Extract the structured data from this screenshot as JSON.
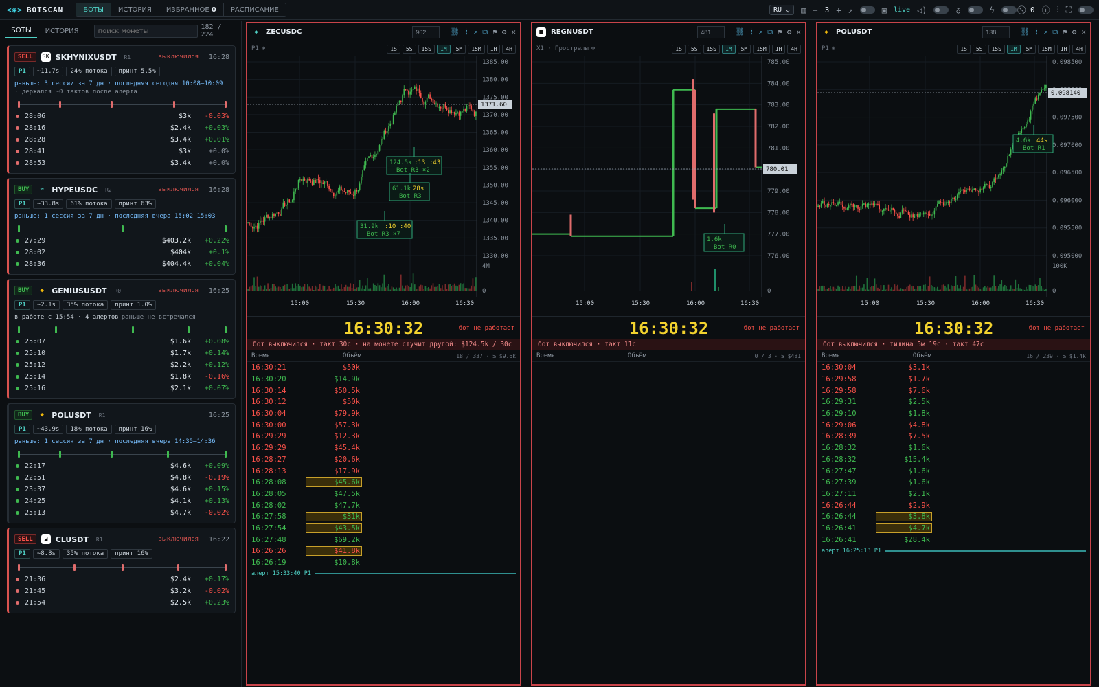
{
  "app": {
    "name": "BOTSCAN"
  },
  "nav": {
    "tabs": [
      "БОТЫ",
      "ИСТОРИЯ",
      "ИЗБРАННОЕ",
      "РАСПИСАНИЕ"
    ],
    "fav_count": "0",
    "active": "БОТЫ"
  },
  "toolbar": {
    "lang": "RU",
    "grid_minus": "−",
    "grid_count": "3",
    "grid_plus": "+",
    "live": "live",
    "blocked_count": "0"
  },
  "sidebar": {
    "tabs": [
      "БОТЫ",
      "ИСТОРИЯ"
    ],
    "search_placeholder": "поиск монеты",
    "count": "182 / 224",
    "cards": [
      {
        "side": "SELL",
        "symbol": "SKHYNIXUSDT",
        "rank": "R1",
        "status": "выключился",
        "time": "16:28",
        "p": "P1",
        "lat": "~11.7s",
        "flow": "24% потока",
        "print": "принт 5.5%",
        "note": "раньше: 3 сессии за 7 дн · последняя сегодня 10:08–10:09",
        "note2": "· держался ~0 тактов после алерта",
        "icon_color": "#ffffff",
        "icon_txt": "SK",
        "ticks": [
          0,
          0.2,
          0.45,
          0.75,
          1.0
        ],
        "tick_color": "#e06c6c",
        "rows": [
          [
            "28:06",
            "$3k",
            "-0.03%"
          ],
          [
            "28:16",
            "$2.4k",
            "+0.03%"
          ],
          [
            "28:28",
            "$3.4k",
            "+0.01%"
          ],
          [
            "28:41",
            "$3k",
            "+0.0%"
          ],
          [
            "28:53",
            "$3.4k",
            "+0.0%"
          ]
        ]
      },
      {
        "side": "BUY",
        "symbol": "HYPEUSDC",
        "rank": "R2",
        "status": "выключился",
        "time": "16:28",
        "p": "P1",
        "lat": "~33.8s",
        "flow": "61% потока",
        "print": "принт 63%",
        "note": "раньше: 1 сессия за 7 дн · последняя вчера 15:02–15:03",
        "note2": "",
        "icon_color": "#4fd1c5",
        "icon_txt": "≈",
        "ticks": [
          0,
          0.5,
          1.0
        ],
        "tick_color": "#3fb950",
        "rows": [
          [
            "27:29",
            "$403.2k",
            "+0.22%"
          ],
          [
            "28:02",
            "$404k",
            "+0.1%"
          ],
          [
            "28:36",
            "$404.4k",
            "+0.04%"
          ]
        ]
      },
      {
        "side": "BUY",
        "symbol": "GENIUSUSDT",
        "rank": "R0",
        "status": "выключился",
        "time": "16:25",
        "p": "P1",
        "lat": "~2.1s",
        "flow": "35% потока",
        "print": "принт 1.0%",
        "note": "в работе с 15:54 · 4 алертов",
        "note_tail": "раньше не встречался",
        "note2": "",
        "icon_color": "#f0b90b",
        "icon_txt": "◆",
        "ticks": [
          0,
          0.18,
          0.55,
          0.82,
          1.0
        ],
        "tick_color": "#3fb950",
        "rows": [
          [
            "25:07",
            "$1.6k",
            "+0.08%"
          ],
          [
            "25:10",
            "$1.7k",
            "+0.14%"
          ],
          [
            "25:12",
            "$2.2k",
            "+0.12%"
          ],
          [
            "25:14",
            "$1.8k",
            "-0.16%"
          ],
          [
            "25:16",
            "$2.1k",
            "+0.07%"
          ]
        ]
      },
      {
        "side": "BUY",
        "symbol": "POLUSDT",
        "rank": "R1",
        "status": "",
        "time": "16:25",
        "p": "P1",
        "lat": "~43.9s",
        "flow": "18% потока",
        "print": "принт 16%",
        "note": "раньше: 1 сессия за 7 дн · последняя вчера 14:35–14:36",
        "note2": "",
        "icon_color": "#f0b90b",
        "icon_txt": "◆",
        "ticks": [
          0,
          0.2,
          0.45,
          0.72,
          1.0
        ],
        "tick_color": "#3fb950",
        "rows": [
          [
            "22:17",
            "$4.6k",
            "+0.09%"
          ],
          [
            "22:51",
            "$4.8k",
            "-0.19%"
          ],
          [
            "23:37",
            "$4.6k",
            "+0.15%"
          ],
          [
            "24:25",
            "$4.1k",
            "+0.13%"
          ],
          [
            "25:13",
            "$4.7k",
            "-0.02%"
          ]
        ]
      },
      {
        "side": "SELL",
        "symbol": "CLUSDT",
        "rank": "R1",
        "status": "выключился",
        "time": "16:22",
        "p": "P1",
        "lat": "~8.8s",
        "flow": "35% потока",
        "print": "принт 16%",
        "note": "",
        "note2": "",
        "icon_color": "#ffffff",
        "icon_txt": "◢",
        "ticks": [
          0,
          0.27,
          0.5,
          0.77,
          1.0
        ],
        "tick_color": "#e06c6c",
        "rows": [
          [
            "21:36",
            "$2.4k",
            "+0.17%"
          ],
          [
            "21:45",
            "$3.2k",
            "-0.02%"
          ],
          [
            "21:54",
            "$2.5k",
            "+0.23%"
          ]
        ]
      }
    ]
  },
  "timeframes": [
    "1S",
    "5S",
    "15S",
    "1M",
    "5M",
    "15M",
    "1H",
    "4H"
  ],
  "panels": [
    {
      "symbol": "ZECUSDC",
      "input": "962",
      "sub": "P1",
      "clock": "16:30:32",
      "status": "бот не работает",
      "banner": "бот выключился · такт 30с · на монете стучит другой: $124.5k / 30с",
      "col_time": "Время",
      "col_vol": "Объём",
      "meta": "18 / 337 · ≥ $9.6k",
      "alert": "алерт 15:33:40 P1",
      "icon_color": "#4fd1c5",
      "trades": [
        [
          "16:30:21",
          "$50k",
          "r",
          0
        ],
        [
          "16:30:20",
          "$14.9k",
          "g",
          0
        ],
        [
          "16:30:14",
          "$50.5k",
          "r",
          0
        ],
        [
          "16:30:12",
          "$50k",
          "r",
          0
        ],
        [
          "16:30:04",
          "$79.9k",
          "r",
          0
        ],
        [
          "16:30:00",
          "$57.3k",
          "r",
          0
        ],
        [
          "16:29:29",
          "$12.3k",
          "r",
          0
        ],
        [
          "16:29:29",
          "$45.4k",
          "r",
          0
        ],
        [
          "16:28:27",
          "$20.6k",
          "r",
          0
        ],
        [
          "16:28:13",
          "$17.9k",
          "r",
          0
        ],
        [
          "16:28:08",
          "$45.6k",
          "g",
          1
        ],
        [
          "16:28:05",
          "$47.5k",
          "g",
          0
        ],
        [
          "16:28:02",
          "$47.7k",
          "g",
          0
        ],
        [
          "16:27:58",
          "$31k",
          "g",
          1
        ],
        [
          "16:27:54",
          "$43.5k",
          "g",
          1
        ],
        [
          "16:27:48",
          "$69.2k",
          "g",
          0
        ],
        [
          "16:26:26",
          "$41.8k",
          "r",
          1
        ],
        [
          "16:26:19",
          "$10.8k",
          "g",
          0
        ]
      ],
      "chart": {
        "yticks": [
          "1385.00",
          "1380.00",
          "1375.00",
          "1370.00",
          "1365.00",
          "1360.00",
          "1355.00",
          "1350.00",
          "1345.00",
          "1340.00",
          "1335.00",
          "1330.00"
        ],
        "price": "1371.60",
        "xticks": [
          "15:00",
          "15:30",
          "16:00",
          "16:30"
        ],
        "vol": [
          "4M",
          "0"
        ],
        "labels": [
          {
            "a": "124.5k",
            "b": ":13",
            "c": ":43",
            "d": "Bot R3 ×2"
          },
          {
            "a": "61.1k",
            "b": "28s",
            "c": "",
            "d": "Bot R3"
          },
          {
            "a": "31.9k",
            "b": ":10",
            "c": ":40",
            "d": "Bot R3 ×7"
          }
        ]
      }
    },
    {
      "symbol": "REGNUSDT",
      "input": "481",
      "sub": "X1 · Прострелы",
      "clock": "16:30:32",
      "status": "бот не работает",
      "banner": "бот выключился · такт 11с",
      "col_time": "Время",
      "col_vol": "Объём",
      "meta": "0 / 3 · ≥ $481",
      "alert": "",
      "icon_color": "#ffffff",
      "trades": [],
      "chart": {
        "yticks": [
          "785.00",
          "784.00",
          "783.00",
          "782.00",
          "781.00",
          "780.00",
          "779.00",
          "778.00",
          "777.00",
          "776.00"
        ],
        "price": "780.01",
        "xticks": [
          "15:00",
          "15:30",
          "16:00",
          "16:30"
        ],
        "vol": [
          "0"
        ],
        "labels": [
          {
            "a": "1.6k",
            "b": "",
            "c": "",
            "d": "Bot R0"
          }
        ]
      }
    },
    {
      "symbol": "POLUSDT",
      "input": "138",
      "sub": "P1",
      "clock": "16:30:32",
      "status": "бот не работает",
      "banner": "бот выключился · тишина 5м 19с · такт 47с",
      "col_time": "Время",
      "col_vol": "Объём",
      "meta": "16 / 239 · ≥ $1.4k",
      "alert": "алерт 16:25:13 P1",
      "icon_color": "#f0b90b",
      "trades": [
        [
          "16:30:04",
          "$3.1k",
          "r",
          0
        ],
        [
          "16:29:58",
          "$1.7k",
          "r",
          0
        ],
        [
          "16:29:58",
          "$7.6k",
          "r",
          0
        ],
        [
          "16:29:31",
          "$2.5k",
          "g",
          0
        ],
        [
          "16:29:10",
          "$1.8k",
          "g",
          0
        ],
        [
          "16:29:06",
          "$4.8k",
          "r",
          0
        ],
        [
          "16:28:39",
          "$7.5k",
          "r",
          0
        ],
        [
          "16:28:32",
          "$1.6k",
          "g",
          0
        ],
        [
          "16:28:32",
          "$15.4k",
          "g",
          0
        ],
        [
          "16:27:47",
          "$1.6k",
          "g",
          0
        ],
        [
          "16:27:39",
          "$1.6k",
          "g",
          0
        ],
        [
          "16:27:11",
          "$2.1k",
          "g",
          0
        ],
        [
          "16:26:44",
          "$2.9k",
          "r",
          0
        ],
        [
          "16:26:44",
          "$3.8k",
          "g",
          1
        ],
        [
          "16:26:41",
          "$4.7k",
          "g",
          1
        ],
        [
          "16:26:41",
          "$28.4k",
          "g",
          0
        ]
      ],
      "chart": {
        "yticks": [
          "0.098500",
          "0.098000",
          "0.097500",
          "0.097000",
          "0.096500",
          "0.096000",
          "0.095500",
          "0.095000"
        ],
        "price": "0.098140",
        "xticks": [
          "15:00",
          "15:30",
          "16:00",
          "16:30"
        ],
        "vol": [
          "100K",
          "0"
        ],
        "labels": [
          {
            "a": "4.6k",
            "b": "44s",
            "c": "",
            "d": "Bot R1"
          }
        ]
      }
    }
  ],
  "colors": {
    "accent": "#4fd1c5",
    "up": "#3fb950",
    "down": "#f85149",
    "clock": "#f2d22e",
    "panel_border": "#c9444a"
  }
}
